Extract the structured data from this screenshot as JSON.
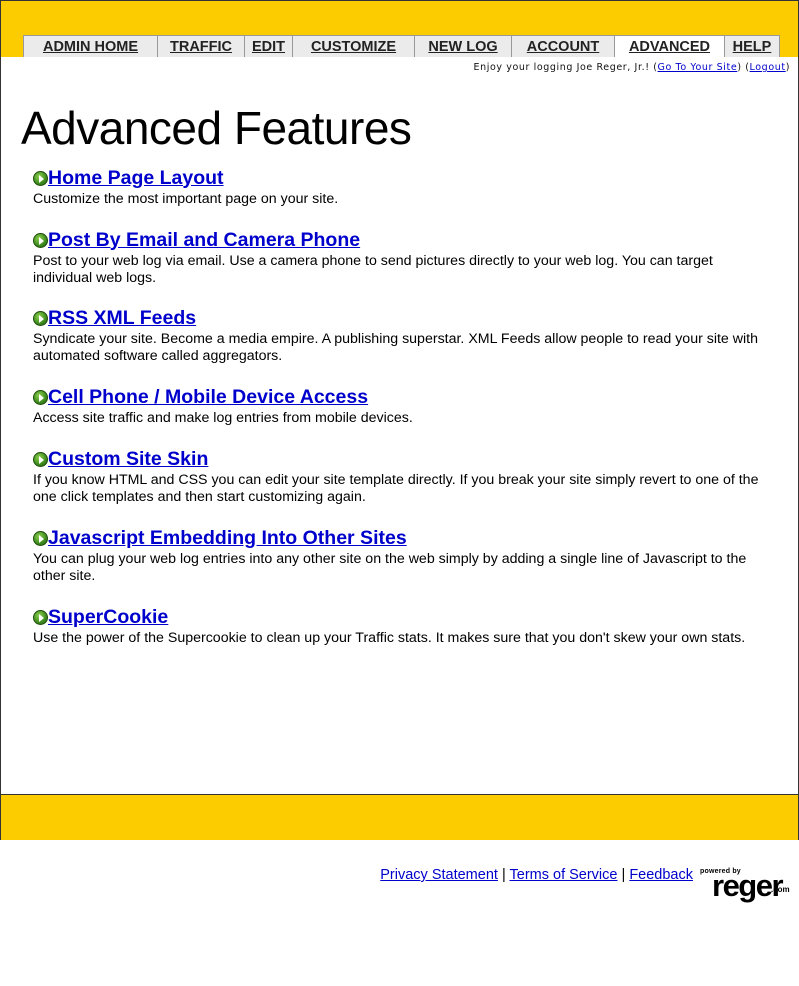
{
  "nav": {
    "tabs": [
      {
        "label": "ADMIN HOME",
        "active": false
      },
      {
        "label": "TRAFFIC",
        "active": false
      },
      {
        "label": "EDIT",
        "active": false
      },
      {
        "label": "CUSTOMIZE",
        "active": false
      },
      {
        "label": "NEW LOG",
        "active": false
      },
      {
        "label": "ACCOUNT",
        "active": false
      },
      {
        "label": "ADVANCED",
        "active": true
      },
      {
        "label": "HELP",
        "active": false
      }
    ]
  },
  "user": {
    "greeting": "Enjoy your logging Joe Reger, Jr.!",
    "go_to_site": "Go To Your Site",
    "logout": "Logout"
  },
  "page": {
    "title": "Advanced Features"
  },
  "features": [
    {
      "title": "Home Page Layout",
      "description": "Customize the most important page on your site."
    },
    {
      "title": "Post By Email and Camera Phone",
      "description": "Post to your web log via email. Use a camera phone to send pictures directly to your web log. You can target individual web logs."
    },
    {
      "title": "RSS XML Feeds",
      "description": "Syndicate your site. Become a media empire. A publishing superstar. XML Feeds allow people to read your site with automated software called aggregators."
    },
    {
      "title": "Cell Phone / Mobile Device Access",
      "description": "Access site traffic and make log entries from mobile devices."
    },
    {
      "title": "Custom Site Skin",
      "description": "If you know HTML and CSS you can edit your site template directly. If you break your site simply revert to one of the one click templates and then start customizing again."
    },
    {
      "title": "Javascript Embedding Into Other Sites",
      "description": "You can plug your web log entries into any other site on the web simply by adding a single line of Javascript to the other site."
    },
    {
      "title": "SuperCookie",
      "description": "Use the power of the Supercookie to clean up your Traffic stats. It makes sure that you don't skew your own stats."
    }
  ],
  "footer": {
    "privacy": "Privacy Statement",
    "terms": "Terms of Service",
    "feedback": "Feedback",
    "logo_small": "powered by",
    "logo_main": "reger",
    "logo_suffix": ".com"
  },
  "colors": {
    "accent_yellow": "#FCCC00",
    "link_blue": "#0000CC",
    "tab_gray": "#EBEBEB"
  }
}
